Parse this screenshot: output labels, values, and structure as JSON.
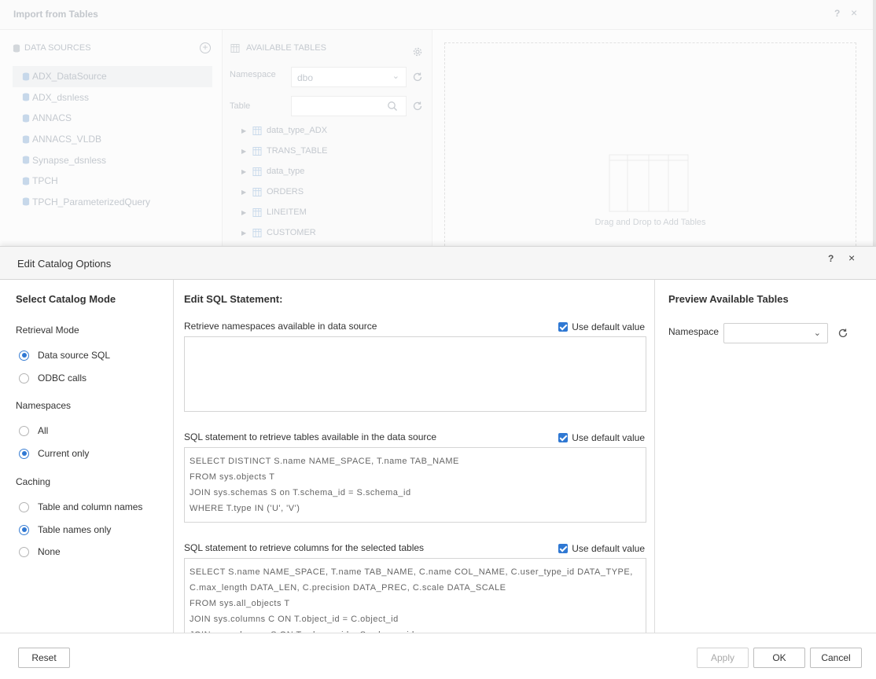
{
  "background_dialog": {
    "title": "Import from Tables",
    "help_label": "?",
    "close_label": "×",
    "data_sources": {
      "header": "DATA SOURCES",
      "items": [
        "ADX_DataSource",
        "ADX_dsnless",
        "ANNACS",
        "ANNACS_VLDB",
        "Synapse_dsnless",
        "TPCH",
        "TPCH_ParameterizedQuery"
      ]
    },
    "available_tables": {
      "header": "AVAILABLE TABLES",
      "namespace_label": "Namespace",
      "namespace_value": "dbo",
      "table_label": "Table",
      "table_value": "",
      "items": [
        "data_type_ADX",
        "TRANS_TABLE",
        "data_type",
        "ORDERS",
        "LINEITEM",
        "CUSTOMER"
      ]
    },
    "drop_zone_text": "Drag and Drop to Add Tables"
  },
  "dialog": {
    "title": "Edit Catalog Options",
    "help_label": "?",
    "close_label": "×",
    "left": {
      "title": "Select Catalog Mode",
      "retrieval_mode": {
        "label": "Retrieval Mode",
        "options": [
          "Data source SQL",
          "ODBC calls"
        ],
        "selected": "Data source SQL"
      },
      "namespaces": {
        "label": "Namespaces",
        "options": [
          "All",
          "Current only"
        ],
        "selected": "Current only"
      },
      "caching": {
        "label": "Caching",
        "options": [
          "Table and column names",
          "Table names only",
          "None"
        ],
        "selected": "Table names only"
      }
    },
    "middle": {
      "title": "Edit SQL Statement:",
      "use_default_label": "Use default value",
      "statements": [
        {
          "label": "Retrieve namespaces available in data source",
          "use_default": true,
          "sql": ""
        },
        {
          "label": "SQL statement to retrieve tables available in the data source",
          "use_default": true,
          "sql": "SELECT DISTINCT S.name NAME_SPACE, T.name TAB_NAME\nFROM sys.objects T\nJOIN sys.schemas S on T.schema_id = S.schema_id\nWHERE T.type IN ('U', 'V')"
        },
        {
          "label": "SQL statement to retrieve columns for the selected tables",
          "use_default": true,
          "sql": "SELECT S.name NAME_SPACE, T.name TAB_NAME, C.name COL_NAME, C.user_type_id DATA_TYPE, C.max_length DATA_LEN, C.precision DATA_PREC, C.scale DATA_SCALE\nFROM sys.all_objects T\nJOIN sys.columns C ON T.object_id = C.object_id\nJOIN sys.schemas S ON T.schema_id = S.schema_id"
        }
      ]
    },
    "right": {
      "title": "Preview Available Tables",
      "namespace_label": "Namespace",
      "namespace_value": ""
    },
    "footer": {
      "reset": "Reset",
      "apply": "Apply",
      "ok": "OK",
      "cancel": "Cancel"
    }
  },
  "colors": {
    "accent": "#2f78d3",
    "border": "#dcdcdc",
    "disabled_text": "#c4c9cf"
  },
  "icons": {
    "database": "database-icon",
    "add": "add-circle-icon",
    "table": "table-grid-icon",
    "gear": "gear-icon",
    "refresh": "refresh-icon",
    "search": "search-icon",
    "chevron": "chevron-down-icon",
    "expand": "caret-right-icon"
  }
}
